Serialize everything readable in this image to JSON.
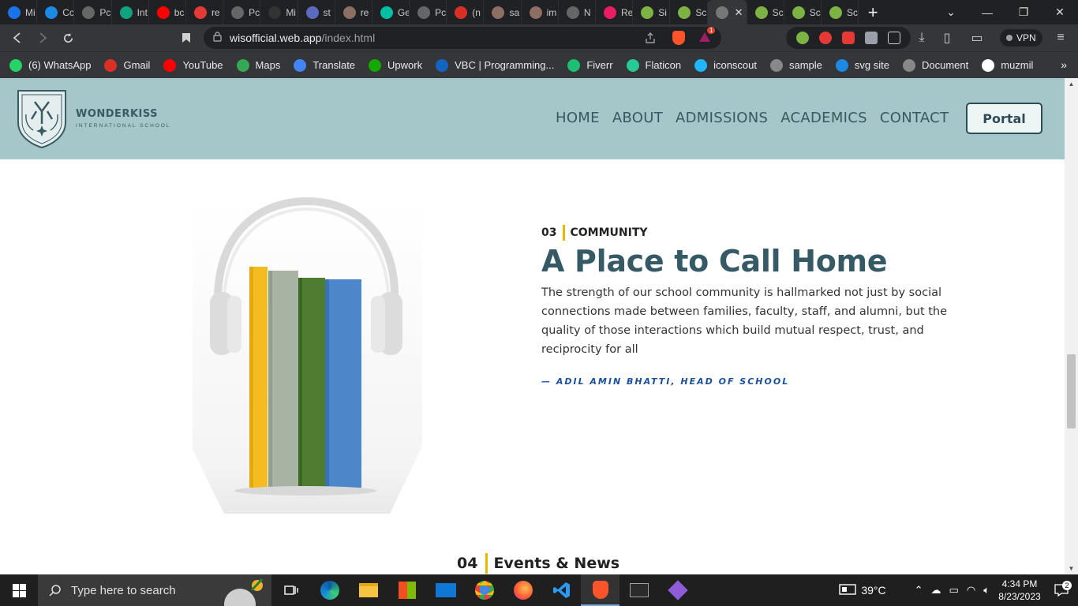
{
  "browser": {
    "tabs": [
      {
        "label": "Mi",
        "color": "#1a73e8"
      },
      {
        "label": "Cc",
        "color": "#1e88e5"
      },
      {
        "label": "Pc",
        "color": "#666"
      },
      {
        "label": "Int",
        "color": "#10a37f"
      },
      {
        "label": "bc",
        "color": "#ff0000"
      },
      {
        "label": "re",
        "color": "#e53935"
      },
      {
        "label": "Pc",
        "color": "#666"
      },
      {
        "label": "Mi",
        "color": "#333"
      },
      {
        "label": "st",
        "color": "#5c6bc0"
      },
      {
        "label": "re",
        "color": "#8d6e63"
      },
      {
        "label": "Ge",
        "color": "#00bfa5"
      },
      {
        "label": "Pc",
        "color": "#666"
      },
      {
        "label": "(n",
        "color": "#d93025"
      },
      {
        "label": "sa",
        "color": "#8d6e63"
      },
      {
        "label": "im",
        "color": "#8d6e63"
      },
      {
        "label": "N",
        "color": "#666"
      },
      {
        "label": "Re",
        "color": "#e91e63"
      },
      {
        "label": "Si",
        "color": "#7cb342"
      },
      {
        "label": "Sc",
        "color": "#7cb342"
      },
      {
        "label": "Sc",
        "color": "#7cb342"
      },
      {
        "label": "Sc",
        "color": "#7cb342"
      },
      {
        "label": "Sc",
        "color": "#7cb342"
      }
    ],
    "active_tab_label": "",
    "url_host": "wisofficial.web.app",
    "url_path": "/index.html",
    "brave_badge": "1",
    "vpn_label": "VPN",
    "bookmarks": [
      {
        "label": "(6) WhatsApp",
        "color": "#25d366"
      },
      {
        "label": "Gmail",
        "color": "#d93025"
      },
      {
        "label": "YouTube",
        "color": "#ff0000"
      },
      {
        "label": "Maps",
        "color": "#34a853"
      },
      {
        "label": "Translate",
        "color": "#4285f4"
      },
      {
        "label": "Upwork",
        "color": "#14a800"
      },
      {
        "label": "VBC | Programming...",
        "color": "#1565c0"
      },
      {
        "label": "Fiverr",
        "color": "#1dbf73"
      },
      {
        "label": "Flaticon",
        "color": "#27c995"
      },
      {
        "label": "iconscout",
        "color": "#1fb6ff"
      },
      {
        "label": "sample",
        "color": "#888"
      },
      {
        "label": "svg site",
        "color": "#1e88e5"
      },
      {
        "label": "Document",
        "color": "#888"
      },
      {
        "label": "muzmil",
        "color": "#fff"
      }
    ]
  },
  "site": {
    "logo_name": "WONDERKISS",
    "logo_sub": "INTERNATIONAL SCHOOL",
    "nav": [
      "HOME",
      "ABOUT",
      "ADMISSIONS",
      "ACADEMICS",
      "CONTACT"
    ],
    "portal_label": "Portal",
    "section": {
      "number": "03",
      "eyebrow": "COMMUNITY",
      "headline": "A Place to Call Home",
      "body": "The strength of our school community is hallmarked not just by social connections made between families, faculty, staff, and alumni, but the quality of those interactions which build mutual respect, trust, and reciprocity for all",
      "quote": "— ADIL AMIN BHATTI, HEAD OF SCHOOL"
    },
    "next_section": {
      "number": "04",
      "title": "Events & News"
    }
  },
  "taskbar": {
    "search_placeholder": "Type here to search",
    "weather": "39°C",
    "time": "4:34 PM",
    "date": "8/23/2023",
    "notifications": "2"
  }
}
